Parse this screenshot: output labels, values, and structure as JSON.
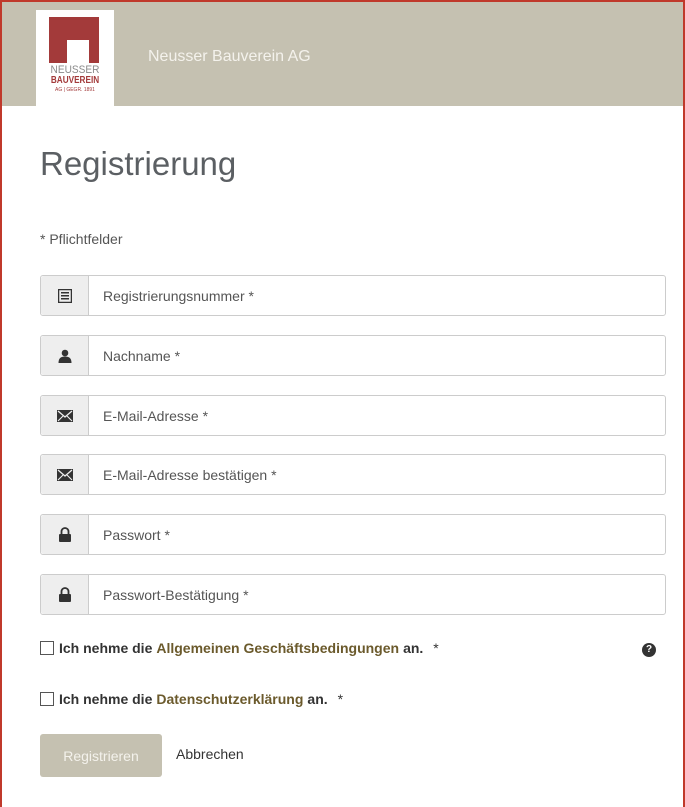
{
  "header": {
    "company_name": "Neusser Bauverein AG",
    "logo_text_top": "NEUSSER",
    "logo_text_middle": "BAUVEREIN",
    "logo_text_bottom": "AG | GEGR. 1891",
    "background": "#c5c1b1",
    "logo_red": "#a33a3a"
  },
  "page": {
    "title": "Registrierung",
    "required_note": "* Pflichtfelder"
  },
  "fields": [
    {
      "icon": "list-icon",
      "placeholder": "Registrierungsnummer *",
      "value": ""
    },
    {
      "icon": "user-icon",
      "placeholder": "Nachname *",
      "value": ""
    },
    {
      "icon": "envelope-icon",
      "placeholder": "E-Mail-Adresse *",
      "value": ""
    },
    {
      "icon": "envelope-icon",
      "placeholder": "E-Mail-Adresse bestätigen *",
      "value": ""
    },
    {
      "icon": "lock-icon",
      "placeholder": "Passwort *",
      "value": ""
    },
    {
      "icon": "lock-icon",
      "placeholder": "Passwort-Bestätigung *",
      "value": ""
    }
  ],
  "agreements": {
    "terms": {
      "prefix": "Ich nehme die",
      "link": "Allgemeinen Geschäftsbedingungen",
      "suffix": "an.",
      "required": "*",
      "checked": false
    },
    "privacy": {
      "prefix": "Ich nehme die",
      "link": "Datenschutzerklärung",
      "suffix": "an.",
      "required": "*",
      "checked": false
    },
    "help_icon": "question-circle-icon"
  },
  "actions": {
    "register_label": "Registrieren",
    "cancel_label": "Abbrechen"
  }
}
